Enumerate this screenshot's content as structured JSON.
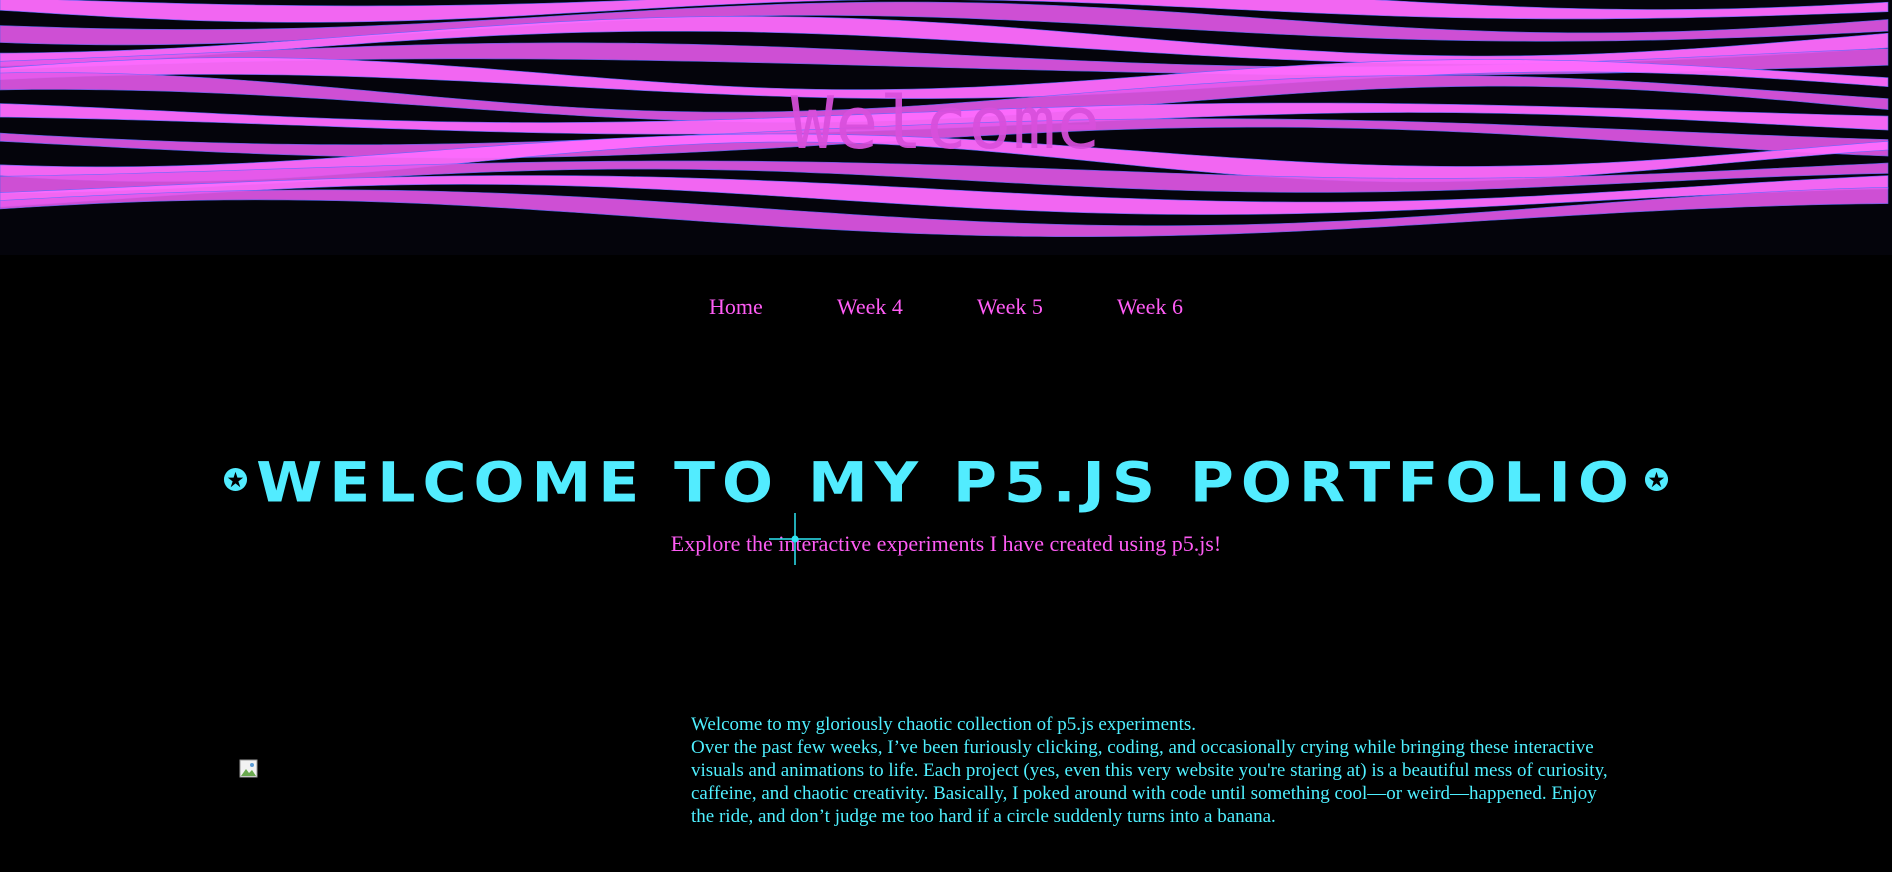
{
  "hero": {
    "title": "Welcome",
    "wave_color": "#e458ea",
    "wave_highlight": "#ff6cff",
    "background": "#04040b"
  },
  "nav": {
    "items": [
      {
        "label": "Home"
      },
      {
        "label": "Week 4"
      },
      {
        "label": "Week 5"
      },
      {
        "label": "Week 6"
      }
    ],
    "color": "#ff5cf5"
  },
  "main": {
    "heading": "WELCOME TO MY P5.JS PORTFOLIO",
    "heading_color": "#52ecff",
    "subtitle": "Explore the interactive experiments I have created using p5.js!"
  },
  "intro": {
    "line1": "Welcome to my gloriously chaotic collection of p5.js experiments.",
    "paragraph": "Over the past few weeks, I’ve been furiously clicking, coding, and occasionally crying while bringing these interactive visuals and animations to life. Each project (yes, even this very website you're staring at) is a beautiful mess of curiosity, caffeine, and chaotic creativity. Basically, I poked around with code until something cool—or weird—happened. Enjoy the ride, and don’t judge me too hard if a circle suddenly turns into a banana."
  },
  "icons": {
    "heading_left": "star-circle-icon",
    "heading_right": "star-circle-icon",
    "cursor": "crosshair-icon",
    "image": "broken-image-icon"
  }
}
